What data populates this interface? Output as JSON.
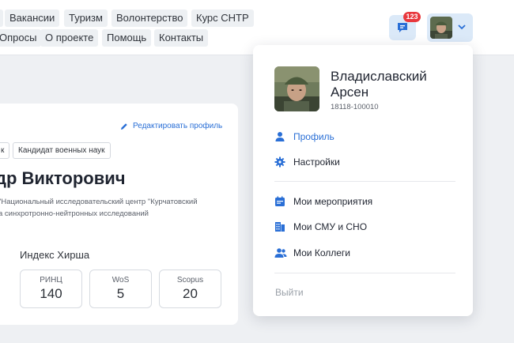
{
  "header": {
    "nav_row1": [
      "Вакансии",
      "Туризм",
      "Волонтерство",
      "Курс СНТР"
    ],
    "nav_row2": [
      "Опросы",
      "О проекте",
      "Помощь",
      "Контакты"
    ],
    "notifications_count": "123"
  },
  "profile_card": {
    "edit_label": "Редактировать профиль",
    "tags": [
      "к",
      "Кандидат военных наук"
    ],
    "name_fragment": "др Викторович",
    "org_line1": "\"Национальный исследовательский центр \"Курчатовский",
    "org_line2": "а синхротронно-нейтронных исследований",
    "hirsh_title": "Индекс Хирша",
    "metrics": [
      {
        "label": "РИНЦ",
        "value": "140"
      },
      {
        "label": "WoS",
        "value": "5"
      },
      {
        "label": "Scopus",
        "value": "20"
      }
    ]
  },
  "dropdown": {
    "user_name": "Владиславский Арсен",
    "user_id": "18118-100010",
    "menu": [
      {
        "label": "Профиль",
        "icon": "user-icon"
      },
      {
        "label": "Настройки",
        "icon": "gear-icon"
      },
      {
        "label": "Мои мероприятия",
        "icon": "calendar-icon"
      },
      {
        "label": "Мои СМУ и СНО",
        "icon": "building-icon"
      },
      {
        "label": "Мои Коллеги",
        "icon": "users-icon"
      }
    ],
    "logout": "Выйти"
  },
  "colors": {
    "accent": "#2a6fd6",
    "badge": "#e8383d",
    "button_bg": "#dbe9f8",
    "page_bg": "#eef0f3"
  }
}
